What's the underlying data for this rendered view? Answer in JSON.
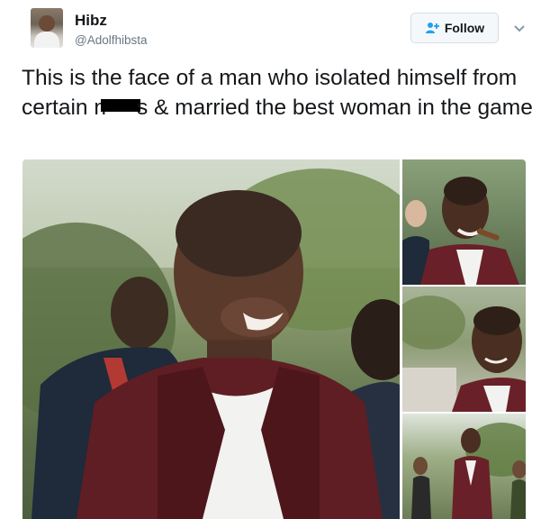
{
  "user": {
    "display_name": "Hibz",
    "handle": "@Adolfhibsta"
  },
  "follow_button": {
    "label": "Follow",
    "icon": "person-add-icon"
  },
  "menu": {
    "icon": "chevron-down-icon"
  },
  "tweet": {
    "text_part1": "This is the face of a man who isolated himself from certain n",
    "text_part2": "s & married the best woman in the game"
  },
  "colors": {
    "text": "#14171a",
    "secondary_text": "#657786",
    "button_bg": "#f5f8fa",
    "button_border": "#d7dde2",
    "follow_icon": "#1da1f2"
  }
}
